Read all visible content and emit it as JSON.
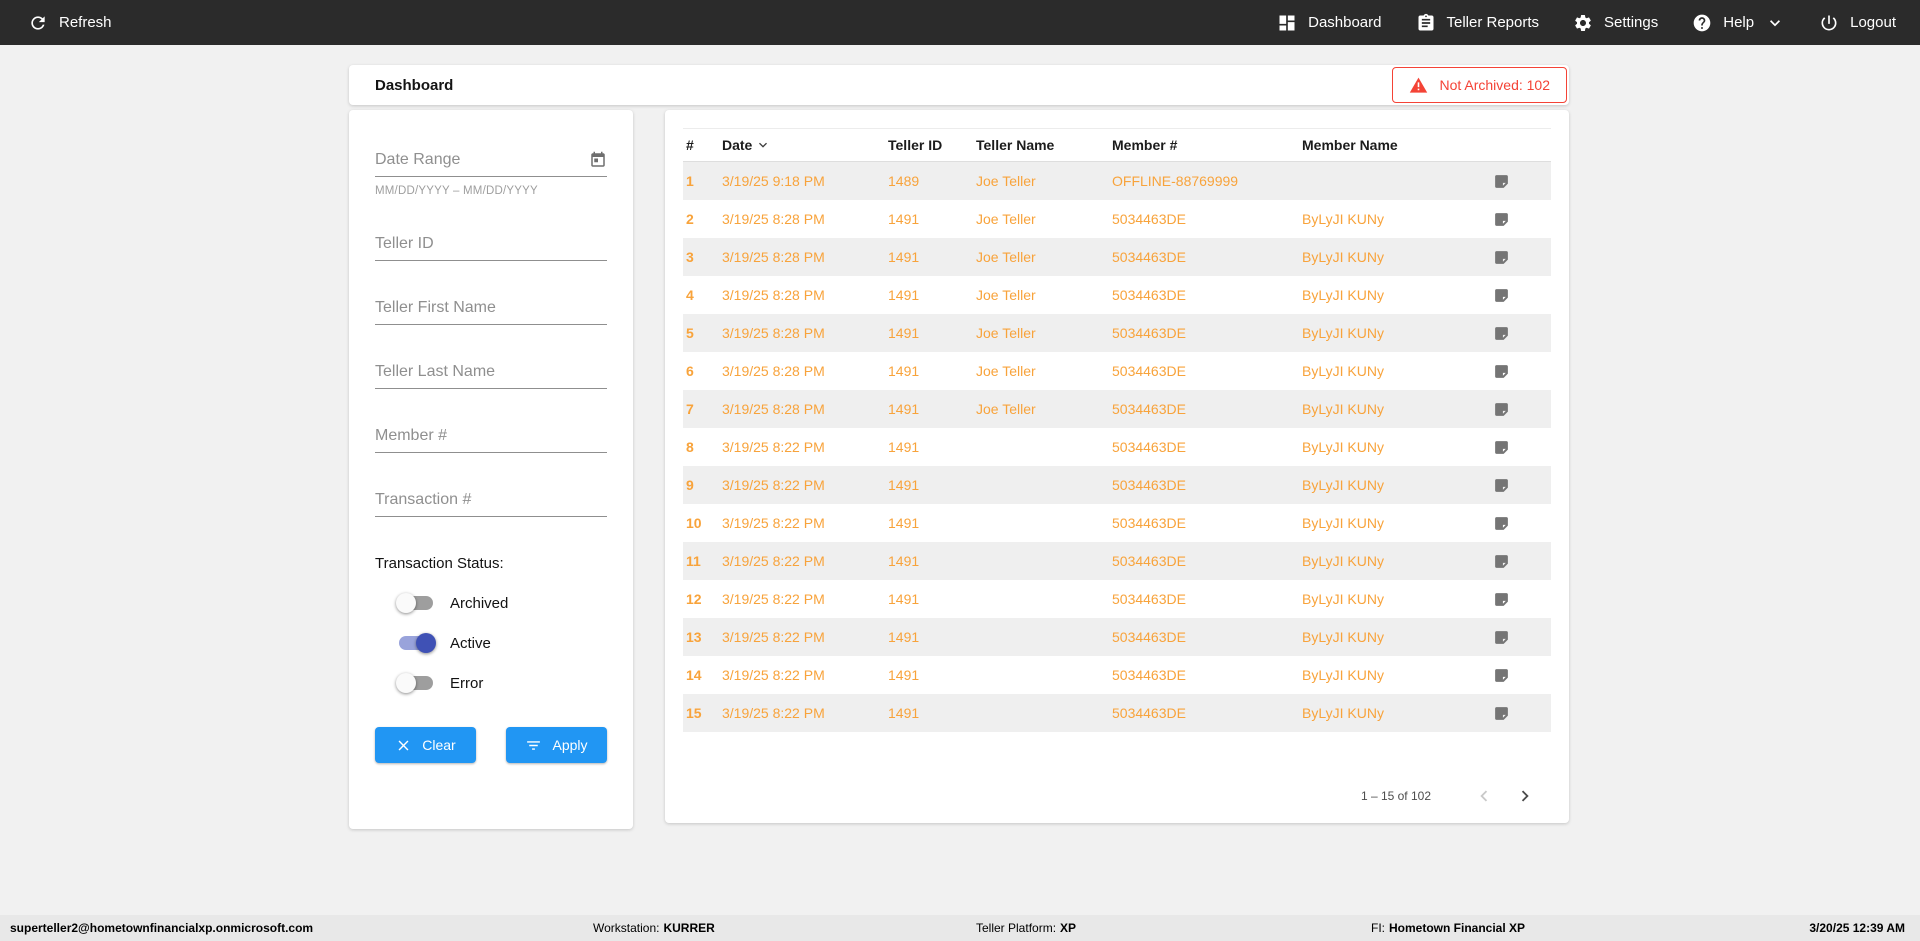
{
  "topbar": {
    "refresh_label": "Refresh",
    "items": [
      {
        "name": "dashboard",
        "label": "Dashboard",
        "icon": "dashboard-grid-icon"
      },
      {
        "name": "teller-reports",
        "label": "Teller Reports",
        "icon": "clipboard-icon"
      },
      {
        "name": "settings",
        "label": "Settings",
        "icon": "gear-icon"
      },
      {
        "name": "help",
        "label": "Help",
        "icon": "help-circle-icon",
        "dropdown": true
      },
      {
        "name": "logout",
        "label": "Logout",
        "icon": "power-icon"
      }
    ]
  },
  "header": {
    "title": "Dashboard",
    "badge_text": "Not Archived: 102"
  },
  "filters": {
    "date_range": {
      "label": "Date Range",
      "hint": "MM/DD/YYYY – MM/DD/YYYY"
    },
    "fields": [
      {
        "name": "teller-id",
        "label": "Teller ID"
      },
      {
        "name": "teller-first-name",
        "label": "Teller First Name"
      },
      {
        "name": "teller-last-name",
        "label": "Teller Last Name"
      },
      {
        "name": "member-number",
        "label": "Member #"
      },
      {
        "name": "transaction-number",
        "label": "Transaction #"
      }
    ],
    "status_label": "Transaction Status:",
    "toggles": [
      {
        "name": "archived",
        "label": "Archived",
        "on": false
      },
      {
        "name": "active",
        "label": "Active",
        "on": true
      },
      {
        "name": "error",
        "label": "Error",
        "on": false
      }
    ],
    "clear_label": "Clear",
    "apply_label": "Apply"
  },
  "table": {
    "columns": [
      "#",
      "Date",
      "Teller ID",
      "Teller Name",
      "Member #",
      "Member Name"
    ],
    "sort_column": "Date",
    "rows": [
      {
        "num": "1",
        "date": "3/19/25 9:18 PM",
        "teller_id": "1489",
        "teller_name": "Joe Teller",
        "member_number": "OFFLINE-88769999",
        "member_name": ""
      },
      {
        "num": "2",
        "date": "3/19/25 8:28 PM",
        "teller_id": "1491",
        "teller_name": "Joe Teller",
        "member_number": "5034463DE",
        "member_name": "ByLyJI KUNy"
      },
      {
        "num": "3",
        "date": "3/19/25 8:28 PM",
        "teller_id": "1491",
        "teller_name": "Joe Teller",
        "member_number": "5034463DE",
        "member_name": "ByLyJI KUNy"
      },
      {
        "num": "4",
        "date": "3/19/25 8:28 PM",
        "teller_id": "1491",
        "teller_name": "Joe Teller",
        "member_number": "5034463DE",
        "member_name": "ByLyJI KUNy"
      },
      {
        "num": "5",
        "date": "3/19/25 8:28 PM",
        "teller_id": "1491",
        "teller_name": "Joe Teller",
        "member_number": "5034463DE",
        "member_name": "ByLyJI KUNy"
      },
      {
        "num": "6",
        "date": "3/19/25 8:28 PM",
        "teller_id": "1491",
        "teller_name": "Joe Teller",
        "member_number": "5034463DE",
        "member_name": "ByLyJI KUNy"
      },
      {
        "num": "7",
        "date": "3/19/25 8:28 PM",
        "teller_id": "1491",
        "teller_name": "Joe Teller",
        "member_number": "5034463DE",
        "member_name": "ByLyJI KUNy"
      },
      {
        "num": "8",
        "date": "3/19/25 8:22 PM",
        "teller_id": "1491",
        "teller_name": "",
        "member_number": "5034463DE",
        "member_name": "ByLyJI KUNy"
      },
      {
        "num": "9",
        "date": "3/19/25 8:22 PM",
        "teller_id": "1491",
        "teller_name": "",
        "member_number": "5034463DE",
        "member_name": "ByLyJI KUNy"
      },
      {
        "num": "10",
        "date": "3/19/25 8:22 PM",
        "teller_id": "1491",
        "teller_name": "",
        "member_number": "5034463DE",
        "member_name": "ByLyJI KUNy"
      },
      {
        "num": "11",
        "date": "3/19/25 8:22 PM",
        "teller_id": "1491",
        "teller_name": "",
        "member_number": "5034463DE",
        "member_name": "ByLyJI KUNy"
      },
      {
        "num": "12",
        "date": "3/19/25 8:22 PM",
        "teller_id": "1491",
        "teller_name": "",
        "member_number": "5034463DE",
        "member_name": "ByLyJI KUNy"
      },
      {
        "num": "13",
        "date": "3/19/25 8:22 PM",
        "teller_id": "1491",
        "teller_name": "",
        "member_number": "5034463DE",
        "member_name": "ByLyJI KUNy"
      },
      {
        "num": "14",
        "date": "3/19/25 8:22 PM",
        "teller_id": "1491",
        "teller_name": "",
        "member_number": "5034463DE",
        "member_name": "ByLyJI KUNy"
      },
      {
        "num": "15",
        "date": "3/19/25 8:22 PM",
        "teller_id": "1491",
        "teller_name": "",
        "member_number": "5034463DE",
        "member_name": "ByLyJI KUNy"
      }
    ],
    "pagination_label": "1 – 15 of 102"
  },
  "statusbar": {
    "user_email": "superteller2@hometownfinancialxp.onmicrosoft.com",
    "workstation_label": "Workstation:",
    "workstation_value": "KURRER",
    "platform_label": "Teller Platform:",
    "platform_value": "XP",
    "fi_label": "FI:",
    "fi_value": "Hometown Financial XP",
    "datetime": "3/20/25 12:39 AM"
  },
  "colors": {
    "topbar_bg": "#2b2b2b",
    "accent_blue": "#2196f3",
    "toggle_on_indigo": "#3f51b5",
    "table_text_orange": "#f8a33b",
    "alert_red": "#f44336"
  }
}
